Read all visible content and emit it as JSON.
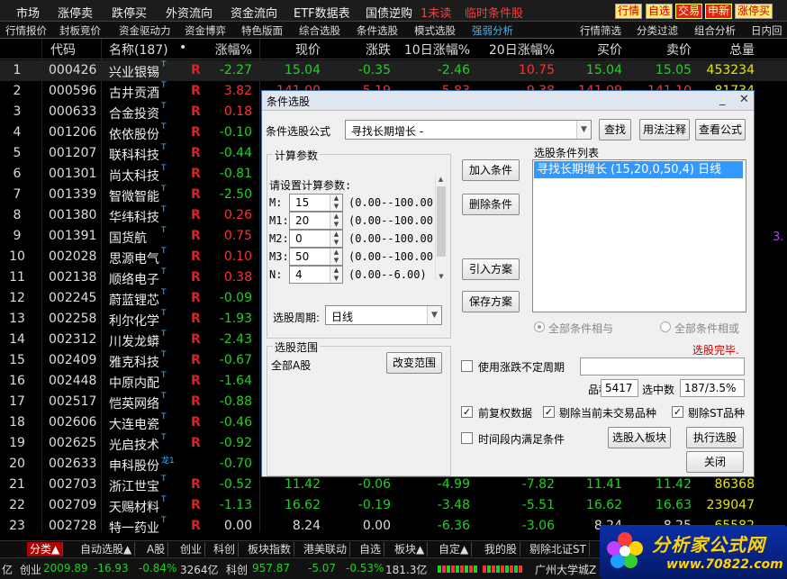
{
  "menubar": {
    "items": [
      "市场",
      "涨停卖",
      "跌停买",
      "外资流向",
      "资金流向",
      "ETF数据表",
      "国债逆购"
    ],
    "alert1": "1未读",
    "alert2": "临时条件股",
    "right_buttons": [
      "行情",
      "自选",
      "交易",
      "申新",
      "涨停买"
    ]
  },
  "subbar": {
    "items": [
      "行情报价",
      "封板竞价",
      "资金驱动力",
      "资金博弈",
      "特色版面",
      "综合选股",
      "条件选股",
      "模式选股",
      "强弱分析"
    ],
    "active": "强弱分析",
    "right_items": [
      "行情筛选",
      "分类过滤",
      "组合分析",
      "日内回首"
    ]
  },
  "table": {
    "headers": [
      "代码",
      "名称(187)",
      "•",
      "涨幅%",
      "现价",
      "涨跌",
      "10日涨幅%",
      "20日涨幅%",
      "买价",
      "卖价",
      "总量"
    ],
    "rows": [
      {
        "idx": "1",
        "code": "000426",
        "name": "兴业银锡",
        "sup": "T",
        "r": "R",
        "pct": "-2.27",
        "price": "15.04",
        "chg": "-0.35",
        "d10": "-2.46",
        "d20": "10.75",
        "buy": "15.04",
        "sell": "15.05",
        "vol": "453234"
      },
      {
        "idx": "2",
        "code": "000596",
        "name": "古井贡酒",
        "sup": "T",
        "r": "R",
        "pct": "3.82",
        "price": "141.00",
        "chg": "5.19",
        "d10": "5.83",
        "d20": "9.38",
        "buy": "141.09",
        "sell": "141.10",
        "vol": "81734"
      },
      {
        "idx": "3",
        "code": "000633",
        "name": "合金投资",
        "sup": "T",
        "r": "R",
        "pct": "0.18",
        "price": "",
        "chg": "",
        "d10": "",
        "d20": "",
        "buy": "",
        "sell": "",
        "vol": ""
      },
      {
        "idx": "4",
        "code": "001206",
        "name": "依依股份",
        "sup": "T",
        "r": "R",
        "pct": "-0.10",
        "price": "",
        "chg": "",
        "d10": "",
        "d20": "",
        "buy": "",
        "sell": "",
        "vol": ""
      },
      {
        "idx": "5",
        "code": "001207",
        "name": "联科科技",
        "sup": "T",
        "r": "R",
        "pct": "-0.44",
        "price": "",
        "chg": "",
        "d10": "",
        "d20": "",
        "buy": "",
        "sell": "",
        "vol": ""
      },
      {
        "idx": "6",
        "code": "001301",
        "name": "尚太科技",
        "sup": "T",
        "r": "R",
        "pct": "-0.81",
        "price": "",
        "chg": "",
        "d10": "",
        "d20": "",
        "buy": "",
        "sell": "",
        "vol": ""
      },
      {
        "idx": "7",
        "code": "001339",
        "name": "智微智能",
        "sup": "T",
        "r": "R",
        "pct": "-2.50",
        "price": "",
        "chg": "",
        "d10": "",
        "d20": "",
        "buy": "",
        "sell": "",
        "vol": ""
      },
      {
        "idx": "8",
        "code": "001380",
        "name": "华纬科技",
        "sup": "T",
        "r": "R",
        "pct": "0.26",
        "price": "",
        "chg": "",
        "d10": "",
        "d20": "",
        "buy": "",
        "sell": "",
        "vol": ""
      },
      {
        "idx": "9",
        "code": "001391",
        "name": "国货航",
        "sup": "T",
        "r": "R",
        "pct": "0.75",
        "price": "",
        "chg": "",
        "d10": "",
        "d20": "",
        "buy": "",
        "sell": "",
        "vol": ""
      },
      {
        "idx": "10",
        "code": "002028",
        "name": "思源电气",
        "sup": "T",
        "r": "R",
        "pct": "0.10",
        "price": "",
        "chg": "",
        "d10": "",
        "d20": "",
        "buy": "",
        "sell": "",
        "vol": ""
      },
      {
        "idx": "11",
        "code": "002138",
        "name": "顺络电子",
        "sup": "T",
        "r": "R",
        "pct": "0.38",
        "price": "",
        "chg": "",
        "d10": "",
        "d20": "",
        "buy": "",
        "sell": "",
        "vol": ""
      },
      {
        "idx": "12",
        "code": "002245",
        "name": "蔚蓝锂芯",
        "sup": "T",
        "r": "R",
        "pct": "-0.09",
        "price": "",
        "chg": "",
        "d10": "",
        "d20": "",
        "buy": "",
        "sell": "",
        "vol": ""
      },
      {
        "idx": "13",
        "code": "002258",
        "name": "利尔化学",
        "sup": "T",
        "r": "R",
        "pct": "-1.93",
        "price": "",
        "chg": "",
        "d10": "",
        "d20": "",
        "buy": "",
        "sell": "",
        "vol": ""
      },
      {
        "idx": "14",
        "code": "002312",
        "name": "川发龙蟒",
        "sup": "T",
        "r": "R",
        "pct": "-2.43",
        "price": "",
        "chg": "",
        "d10": "",
        "d20": "",
        "buy": "",
        "sell": "",
        "vol": ""
      },
      {
        "idx": "15",
        "code": "002409",
        "name": "雅克科技",
        "sup": "T",
        "r": "R",
        "pct": "-0.67",
        "price": "",
        "chg": "",
        "d10": "",
        "d20": "",
        "buy": "",
        "sell": "",
        "vol": ""
      },
      {
        "idx": "16",
        "code": "002448",
        "name": "中原内配",
        "sup": "T",
        "r": "R",
        "pct": "-1.64",
        "price": "",
        "chg": "",
        "d10": "",
        "d20": "",
        "buy": "",
        "sell": "",
        "vol": ""
      },
      {
        "idx": "17",
        "code": "002517",
        "name": "恺英网络",
        "sup": "T",
        "r": "R",
        "pct": "-0.88",
        "price": "",
        "chg": "",
        "d10": "",
        "d20": "",
        "buy": "",
        "sell": "",
        "vol": ""
      },
      {
        "idx": "18",
        "code": "002606",
        "name": "大连电瓷",
        "sup": "T",
        "r": "R",
        "pct": "-0.46",
        "price": "",
        "chg": "",
        "d10": "",
        "d20": "",
        "buy": "",
        "sell": "",
        "vol": ""
      },
      {
        "idx": "19",
        "code": "002625",
        "name": "光启技术",
        "sup": "T",
        "r": "R",
        "pct": "-0.92",
        "price": "",
        "chg": "",
        "d10": "",
        "d20": "",
        "buy": "",
        "sell": "",
        "vol": ""
      },
      {
        "idx": "20",
        "code": "002633",
        "name": "申科股份",
        "sup": "龙1",
        "r": "",
        "pct": "-0.70",
        "price": "",
        "chg": "",
        "d10": "",
        "d20": "",
        "buy": "",
        "sell": "",
        "vol": ""
      },
      {
        "idx": "21",
        "code": "002703",
        "name": "浙江世宝",
        "sup": "T",
        "r": "R",
        "pct": "-0.52",
        "price": "11.42",
        "chg": "-0.06",
        "d10": "-4.99",
        "d20": "-7.82",
        "buy": "11.41",
        "sell": "11.42",
        "vol": "86368"
      },
      {
        "idx": "22",
        "code": "002709",
        "name": "天赐材料",
        "sup": "T",
        "r": "R",
        "pct": "-1.13",
        "price": "16.62",
        "chg": "-0.19",
        "d10": "-3.48",
        "d20": "-5.51",
        "buy": "16.62",
        "sell": "16.63",
        "vol": "239047"
      },
      {
        "idx": "23",
        "code": "002728",
        "name": "特一药业",
        "sup": "T",
        "r": "R",
        "pct": "0.00",
        "price": "8.24",
        "chg": "0.00",
        "d10": "-6.36",
        "d20": "-3.06",
        "buy": "8.24",
        "sell": "8.25",
        "vol": "65582"
      }
    ],
    "side_value": "3."
  },
  "tabbar": {
    "items": [
      "分类▲",
      "自动选股▲",
      "A股",
      "创业",
      "科创",
      "板块指数",
      "港美联动",
      "自选",
      "板块▲",
      "自定▲",
      "我的股",
      "剔除北证ST"
    ]
  },
  "statusbar": {
    "left": "亿",
    "cy_label": "创业",
    "cy_value": "2009.89",
    "cy_chg": "-16.93",
    "cy_pct": "-0.84%",
    "cy_amt": "3264亿",
    "kc_label": "科创",
    "kc_value": "957.87",
    "kc_chg": "-5.07",
    "kc_pct": "-0.53%",
    "kc_amt": "181.3亿",
    "right": "广州大学城Z"
  },
  "logo": {
    "line1": "分析家公式网",
    "line2": "www.70822.com"
  },
  "dialog": {
    "title": "条件选股",
    "formula_label": "条件选股公式",
    "formula_value": "寻找长期增长  -",
    "btn_view": "查找",
    "btn_usage": "用法注释",
    "btn_formula": "查看公式",
    "params_group": "计算参数",
    "params_prompt": "请设置计算参数:",
    "params": [
      {
        "name": "M:",
        "value": "15",
        "range": "(0.00--100.00)"
      },
      {
        "name": "M1:",
        "value": "20",
        "range": "(0.00--100.00)"
      },
      {
        "name": "M2:",
        "value": "0",
        "range": "(0.00--100.00)"
      },
      {
        "name": "M3:",
        "value": "50",
        "range": "(0.00--100.00)"
      },
      {
        "name": "N:",
        "value": "4",
        "range": "(0.00--6.00)"
      }
    ],
    "period_label": "选股周期:",
    "period_value": "日线",
    "btn_add": "加入条件",
    "btn_del": "删除条件",
    "btn_load": "引入方案",
    "btn_save": "保存方案",
    "list_label": "选股条件列表",
    "list_item": "寻找长期增长 (15,20,0,50,4) 日线",
    "radio_and": "全部条件相与",
    "radio_or": "全部条件相或",
    "scope_group": "选股范围",
    "scope_value": "全部A股",
    "btn_scope": "改变范围",
    "status": "选股完毕.",
    "use_chg_label": "使用涨跌不定周期",
    "count_label": "品种数",
    "count_value": "5417",
    "hit_label": "选中数",
    "hit_value": "187/3.5%",
    "chk_fq": "前复权数据",
    "chk_notrade": "剔除当前未交易品种",
    "chk_st": "剔除ST品种",
    "chk_period": "时间段内满足条件",
    "btn_board": "选股入板块",
    "btn_run": "执行选股",
    "btn_close": "关闭"
  }
}
